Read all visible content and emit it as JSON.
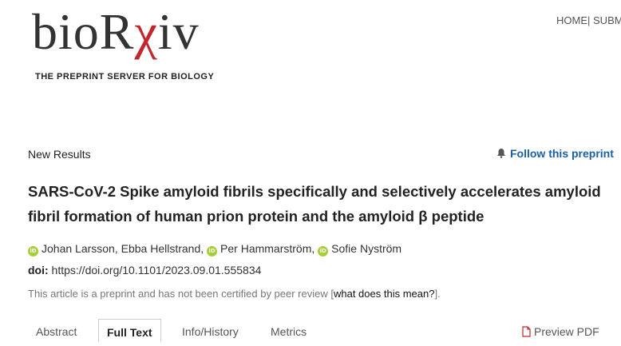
{
  "header": {
    "logo": {
      "text_main": "bioR",
      "text_chi": "χ",
      "text_end": "iv",
      "tagline": "THE PREPRINT SERVER FOR BIOLOGY"
    },
    "nav": {
      "home": "HOME",
      "separator": "|",
      "submit": "SUBM"
    }
  },
  "article": {
    "type": "New Results",
    "follow_label": "Follow this preprint",
    "title": "SARS-CoV-2 Spike amyloid fibrils specifically and selectively accelerates amyloid fibril formation of human prion protein and the amyloid β peptide",
    "authors": [
      "Johan Larsson",
      "Ebba Hellstrand",
      "Per Hammarström",
      "Sofie Nyström"
    ],
    "author_separator": ",",
    "doi_label": "doi:",
    "doi_value": "https://doi.org/10.1101/2023.09.01.555834",
    "notice_prefix": "This article is a preprint and has not been certified by peer review [",
    "notice_link": "what does this mean?",
    "notice_suffix": "]."
  },
  "tabs": [
    {
      "label": "Abstract",
      "active": false
    },
    {
      "label": "Full Text",
      "active": true
    },
    {
      "label": "Info/History",
      "active": false
    },
    {
      "label": "Metrics",
      "active": false
    }
  ],
  "pdf_label": "Preview PDF",
  "colors": {
    "brand_red": "#c1272d",
    "link_blue": "#1b5ea8",
    "orcid_green": "#a6ce39"
  }
}
